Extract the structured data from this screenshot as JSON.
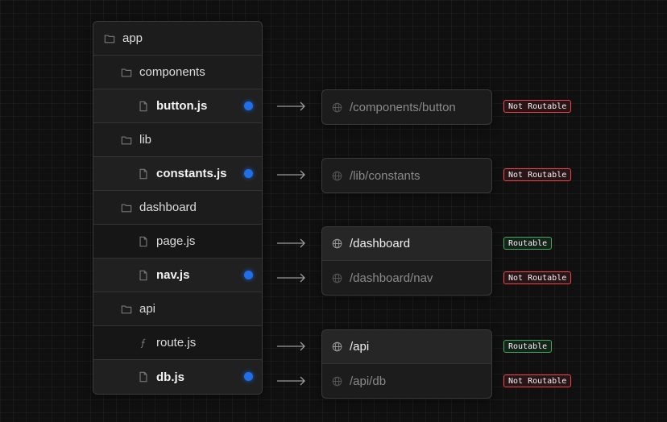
{
  "tree": [
    {
      "label": "app",
      "kind": "folder",
      "icon": "folder-icon"
    },
    {
      "label": "components",
      "kind": "folder",
      "icon": "folder-icon"
    },
    {
      "label": "button.js",
      "kind": "file",
      "icon": "file-icon",
      "highlighted": true
    },
    {
      "label": "lib",
      "kind": "folder",
      "icon": "folder-icon"
    },
    {
      "label": "constants.js",
      "kind": "file",
      "icon": "file-icon",
      "highlighted": true
    },
    {
      "label": "dashboard",
      "kind": "folder",
      "icon": "folder-icon"
    },
    {
      "label": "page.js",
      "kind": "file",
      "icon": "file-icon",
      "highlighted": false
    },
    {
      "label": "nav.js",
      "kind": "file",
      "icon": "file-icon",
      "highlighted": true
    },
    {
      "label": "api",
      "kind": "folder",
      "icon": "folder-icon"
    },
    {
      "label": "route.js",
      "kind": "file",
      "icon": "function-icon",
      "highlighted": false
    },
    {
      "label": "db.js",
      "kind": "file",
      "icon": "file-icon",
      "highlighted": true
    }
  ],
  "routes": [
    {
      "path": "/components/button",
      "routable": false,
      "status": "Not Routable"
    },
    {
      "path": "/lib/constants",
      "routable": false,
      "status": "Not Routable"
    },
    {
      "path": "/dashboard",
      "routable": true,
      "status": "Routable"
    },
    {
      "path": "/dashboard/nav",
      "routable": false,
      "status": "Not Routable"
    },
    {
      "path": "/api",
      "routable": true,
      "status": "Routable"
    },
    {
      "path": "/api/db",
      "routable": false,
      "status": "Not Routable"
    }
  ],
  "colors": {
    "dot": "#1f6feb",
    "not_routable": "#e5484d",
    "routable": "#46a758"
  }
}
